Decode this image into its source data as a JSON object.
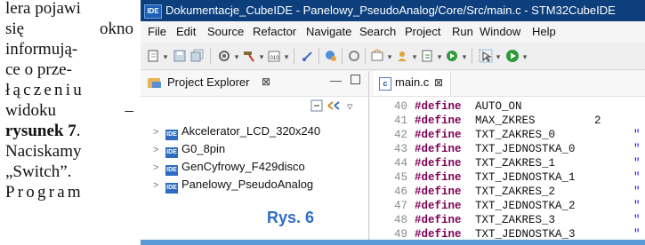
{
  "article": {
    "lines": [
      "lera pojawi",
      "się",
      "okno",
      "informują-",
      "ce o prze-",
      "łączeniu",
      "widoku",
      "–",
      "rysunek 7",
      ".",
      "Naciskamy",
      "„Switch”.",
      "Program"
    ]
  },
  "window": {
    "app_icon": "IDE",
    "title": "Dokumentacje_CubeIDE - Panelowy_PseudoAnalog/Core/Src/main.c - STM32CubeIDE"
  },
  "menu": [
    "File",
    "Edit",
    "Source",
    "Refactor",
    "Navigate",
    "Search",
    "Project",
    "Run",
    "Window",
    "Help"
  ],
  "toolbar": {
    "icons": [
      "new-icon",
      "save-icon",
      "save-all-icon",
      "settings-icon",
      "build-hammer-icon",
      "binary-icon",
      "debug-target-icon",
      "open-element-icon",
      "external-tools-icon",
      "new-class-icon",
      "new-file-icon",
      "refresh-icon",
      "cursor-icon",
      "run-icon"
    ]
  },
  "project_explorer": {
    "tab_label": "Project Explorer",
    "close": "⊠",
    "minimize": "—",
    "projects": [
      {
        "label": "Akcelerator_LCD_320x240",
        "icon": "IDE"
      },
      {
        "label": "G0_8pin",
        "icon": "IDE"
      },
      {
        "label": "GenCyfrowy_F429disco",
        "icon": "IDE"
      },
      {
        "label": "Panelowy_PseudoAnalog",
        "icon": "IDE"
      }
    ]
  },
  "caption": "Rys. 6",
  "editor": {
    "file_tab": "main.c",
    "file_icon": "c",
    "close": "⊠",
    "lines": [
      {
        "num": "40",
        "kw": "#define",
        "name": "AUTO_ON",
        "val": "",
        "q": ""
      },
      {
        "num": "41",
        "kw": "#define",
        "name": "MAX_ZKRES",
        "val": "2",
        "q": ""
      },
      {
        "num": "42",
        "kw": "#define",
        "name": "TXT_ZAKRES_0",
        "val": "",
        "q": "\""
      },
      {
        "num": "43",
        "kw": "#define",
        "name": "TXT_JEDNOSTKA_0",
        "val": "",
        "q": "\""
      },
      {
        "num": "44",
        "kw": "#define",
        "name": "TXT_ZAKRES_1",
        "val": "",
        "q": "\""
      },
      {
        "num": "45",
        "kw": "#define",
        "name": "TXT_JEDNOSTKA_1",
        "val": "",
        "q": "\""
      },
      {
        "num": "46",
        "kw": "#define",
        "name": "TXT_ZAKRES_2",
        "val": "",
        "q": "\""
      },
      {
        "num": "47",
        "kw": "#define",
        "name": "TXT_JEDNOSTKA_2",
        "val": "",
        "q": "\""
      },
      {
        "num": "48",
        "kw": "#define",
        "name": "TXT_ZAKRES_3",
        "val": "",
        "q": "\""
      },
      {
        "num": "49",
        "kw": "#define",
        "name": "TXT_JEDNOSTKA_3",
        "val": "",
        "q": "\""
      }
    ]
  }
}
